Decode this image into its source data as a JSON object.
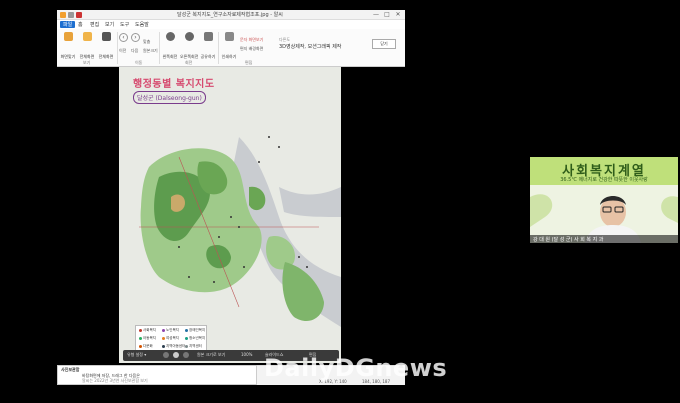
{
  "window": {
    "title": "달성군 복지지도_연구소자료제작협조포.jpg - 알씨",
    "controls": [
      "—",
      "□",
      "✕"
    ]
  },
  "menu": [
    "파일",
    "홈",
    "편집",
    "보기",
    "도구",
    "도움말"
  ],
  "ribbon": {
    "buttons": [
      "화면맞기",
      "전체화면",
      "전체화면",
      "이전",
      "다음",
      "왼쪽회전",
      "오른쪽회전",
      "공유하기",
      "인쇄하기",
      "편집"
    ],
    "small_items": [
      "맞춤",
      "원본크기",
      "문자 화면보기",
      "편지 배경화면"
    ],
    "groups": [
      "보기",
      "이동",
      "회전",
      "편집"
    ],
    "ad_small": "다른도",
    "ad_text": "3D영상제작, 모션그래픽 제작",
    "ad_close": "닫기"
  },
  "map": {
    "title": "행정동별 복지지도",
    "subtitle": "달성군 (Dalseong-gun)",
    "legend": [
      "사회복지",
      "노인복지",
      "장애인복지",
      "아동복지",
      "여성복지",
      "청소년복지",
      "다문화",
      "지역아동센터",
      "지역센터"
    ]
  },
  "viewbar": [
    "유형 설정 ▾",
    "원본 크기로 보기",
    "100%",
    "슬라이드쇼",
    "편집"
  ],
  "popup": {
    "title": "사진보관함",
    "line1": "바탕화면에 저장, 드래그 한 다음은",
    "line2": "알씨는 2022년 3년연 사진보관함 보기"
  },
  "status": {
    "dims": "1 / 2",
    "info": "3024 x 4032 24bpp",
    "size": "4.59 MB",
    "zoom": "97%",
    "coords": "X: 192, Y: 140",
    "rgb": "184, 180, 187"
  },
  "webcam": {
    "banner": "사회복지계열",
    "subtitle": "36.5℃ 에너지로 건강한 따뜻한 이웃사랑",
    "name": "강 대 원 (달 성 군) 사 회 복 지 과"
  },
  "watermark": "DailyDGnews"
}
